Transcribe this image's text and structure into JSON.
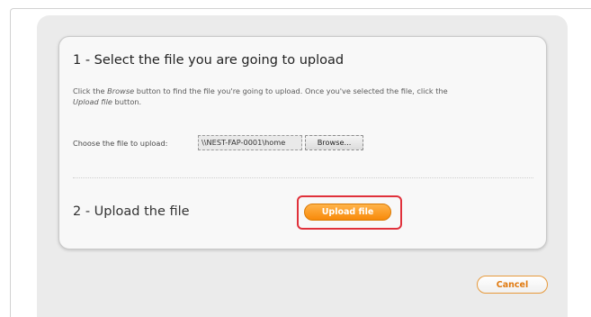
{
  "step1": {
    "title": "1 - Select the file you are going to upload",
    "instructions": {
      "part1": "Click the ",
      "browse_word": "Browse",
      "part2": " button to find the file you're going to upload. Once you've selected the file, click the ",
      "upload_word": "Upload file",
      "part3": " button."
    },
    "choose_label": "Choose the file to upload:",
    "file_path_value": "\\\\NEST-FAP-0001\\home",
    "browse_label": "Browse..."
  },
  "step2": {
    "title": "2 - Upload the file",
    "upload_label": "Upload file"
  },
  "footer": {
    "cancel_label": "Cancel"
  },
  "colors": {
    "accent_orange": "#f88a0a",
    "highlight_red": "#e0313b",
    "panel_gray": "#ebebeb"
  }
}
